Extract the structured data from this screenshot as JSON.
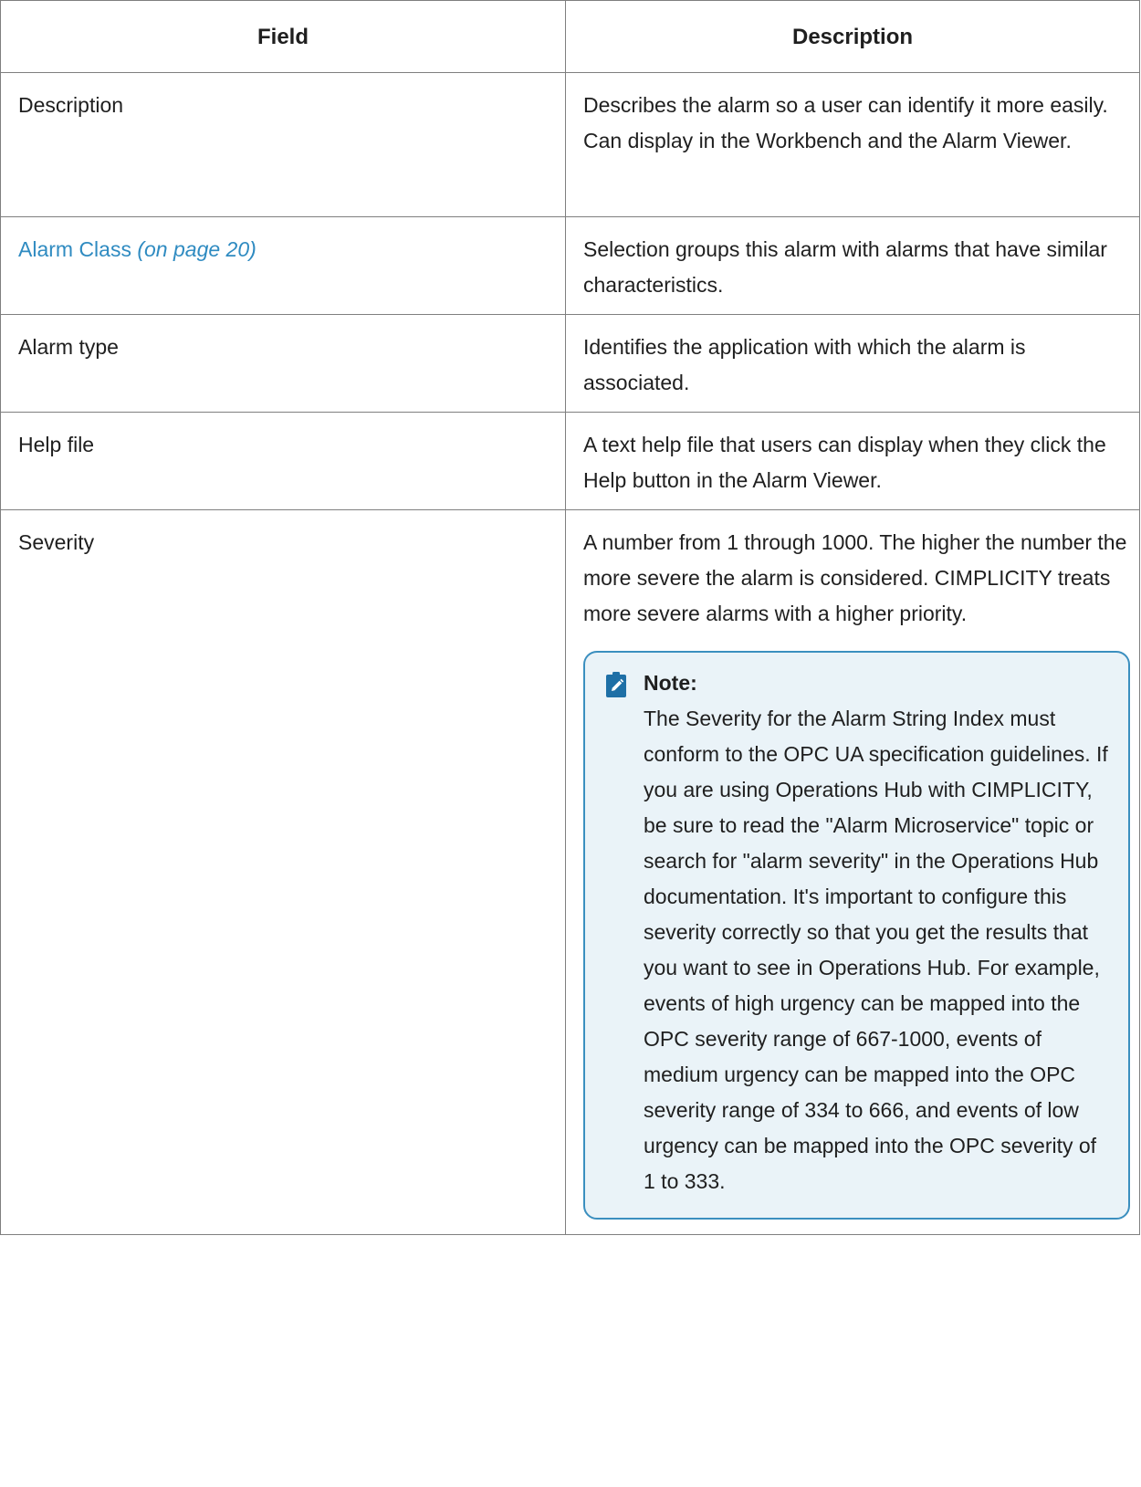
{
  "table": {
    "headers": {
      "field": "Field",
      "description": "Description"
    },
    "rows": [
      {
        "field": "Description",
        "description": "Describes the alarm so a user can identify it more easily. Can display in the Workbench and the Alarm Viewer."
      },
      {
        "field_link": "Alarm Class",
        "field_page_ref": "(on page 20)",
        "description": "Selection groups this alarm with alarms that have similar characteristics."
      },
      {
        "field": "Alarm type",
        "description": "Identifies the application with which the alarm is associated."
      },
      {
        "field": "Help file",
        "description": "A text help file that users can display when they click the Help button in the Alarm Viewer."
      },
      {
        "field": "Severity",
        "description": "A number from 1 through 1000. The higher the number the more severe the alarm is considered. CIMPLICITY treats more severe alarms with a higher priority.",
        "note": {
          "icon": "pencil-note-icon",
          "title": "Note:",
          "body": "The Severity for the Alarm String Index must conform to the OPC UA specification guidelines. If you are using Operations Hub with CIMPLICITY, be sure to read the \"Alarm Microservice\" topic or search for \"alarm severity\" in the Operations Hub documentation. It's important to configure this severity correctly so that you get the results that you want to see in Operations Hub. For example, events of high urgency can be mapped into the OPC severity range of 667-1000, events of medium urgency can be mapped into the OPC severity range of 334 to 666, and events of low urgency can be mapped into the OPC severity of 1 to 333."
        }
      }
    ]
  },
  "colors": {
    "link": "#2f8bc1",
    "note_border": "#3b8fbf",
    "note_background": "#eaf3f8",
    "note_icon": "#1e6fa6",
    "table_border": "#7f7f7f"
  }
}
